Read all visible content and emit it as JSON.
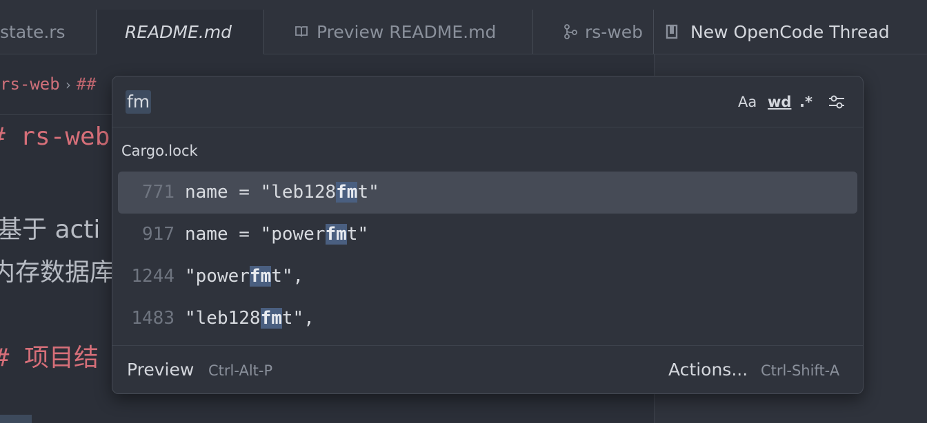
{
  "tabs": [
    {
      "label": "state.rs",
      "icon": "",
      "active": false
    },
    {
      "label": "README.md",
      "icon": "",
      "active": true
    },
    {
      "label": "Preview README.md",
      "icon": "book-icon",
      "active": false
    },
    {
      "label": "rs-web",
      "icon": "branch-icon",
      "active": false
    },
    {
      "label": "New OpenCode Thread",
      "icon": "thread-icon",
      "active": false
    }
  ],
  "breadcrumb": {
    "project": "rs-web",
    "section": "## "
  },
  "editor": {
    "heading1": "# rs-web",
    "line_cjk1": "基于 acti",
    "line_cjk2": "内存数据库",
    "heading2": "## 项目结"
  },
  "search": {
    "query": "fm",
    "options": {
      "case": "Aa",
      "word": "wd",
      "regex": ".*"
    }
  },
  "results": {
    "file": "Cargo.lock",
    "rows": [
      {
        "line": "771",
        "before": "name = \"leb128",
        "match": "fm",
        "after": "t\"",
        "selected": true
      },
      {
        "line": "917",
        "before": "name = \"power",
        "match": "fm",
        "after": "t\"",
        "selected": false
      },
      {
        "line": "1244",
        "before": "\"power",
        "match": "fm",
        "after": "t\",",
        "selected": false
      },
      {
        "line": "1483",
        "before": "\"leb128",
        "match": "fm",
        "after": "t\",",
        "selected": false
      }
    ]
  },
  "footer": {
    "preview_label": "Preview",
    "preview_shortcut": "Ctrl-Alt-P",
    "actions_label": "Actions...",
    "actions_shortcut": "Ctrl-Shift-A"
  },
  "colors": {
    "accent_match": "#4a5f80",
    "heading": "#d66f79",
    "background": "#2b2f38"
  }
}
